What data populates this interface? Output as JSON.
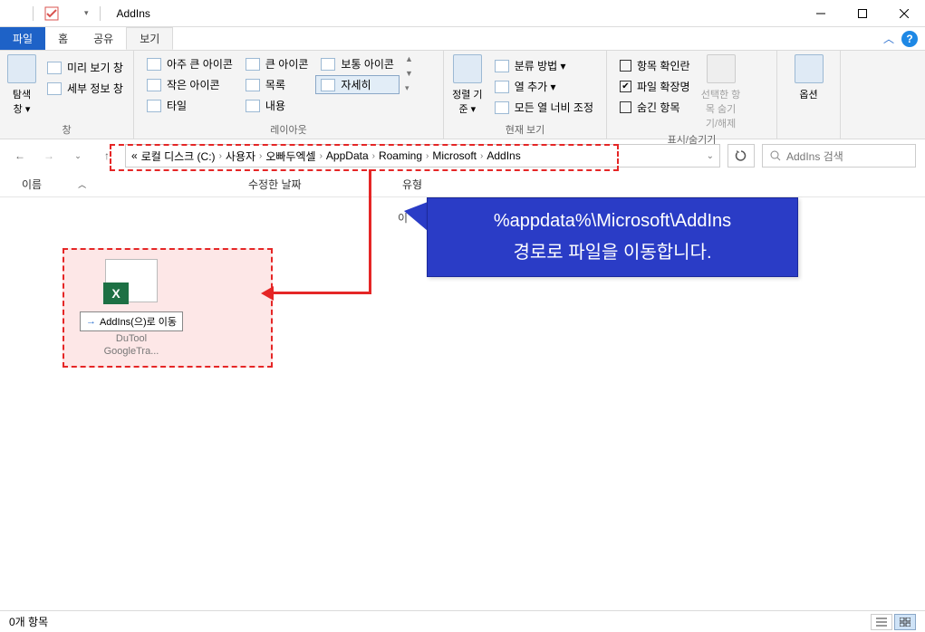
{
  "window": {
    "title": "AddIns"
  },
  "tabs": {
    "file": "파일",
    "home": "홈",
    "share": "공유",
    "view": "보기"
  },
  "ribbon": {
    "panes": {
      "label": "창",
      "nav_pane": "미리 보기 창",
      "search_pane": "탐색 창 ▾",
      "details_pane": "세부 정보 창"
    },
    "layout": {
      "label": "레이아웃",
      "extra_large": "아주 큰 아이콘",
      "small_icons": "작은 아이콘",
      "tiles": "타일",
      "large_icons": "큰 아이콘",
      "list": "목록",
      "content": "내용",
      "medium_icons": "보통 아이콘",
      "details": "자세히"
    },
    "current_view": {
      "label": "현재 보기",
      "sort": "정렬 기준 ▾",
      "group_by": "분류 방법 ▾",
      "add_columns": "열 추가 ▾",
      "size_all": "모든 열 너비 조정"
    },
    "show_hide": {
      "label": "표시/숨기기",
      "item_checkboxes": "항목 확인란",
      "file_ext": "파일 확장명",
      "hidden_items": "숨긴 항목",
      "hide_selected": "선택한 항목 숨기기/해제"
    },
    "options": {
      "label": "옵션",
      "btn": "옵션"
    }
  },
  "breadcrumb": {
    "prefix": "«",
    "items": [
      "로컬 디스크 (C:)",
      "사용자",
      "오빠두엑셀",
      "AppData",
      "Roaming",
      "Microsoft",
      "AddIns"
    ]
  },
  "search": {
    "placeholder": "AddIns 검색"
  },
  "columns": {
    "name": "이름",
    "date": "수정한 날짜",
    "type": "유형"
  },
  "content": {
    "empty": "이",
    "move_tip_prefix": "→",
    "move_tip": "AddIns(으)로 이동",
    "file_name_l1": "DuTool",
    "file_name_l2": "GoogleTra..."
  },
  "callout": {
    "line1": "%appdata%\\Microsoft\\AddIns",
    "line2": "경로로 파일을 이동합니다."
  },
  "status": {
    "count": "0개 항목"
  }
}
